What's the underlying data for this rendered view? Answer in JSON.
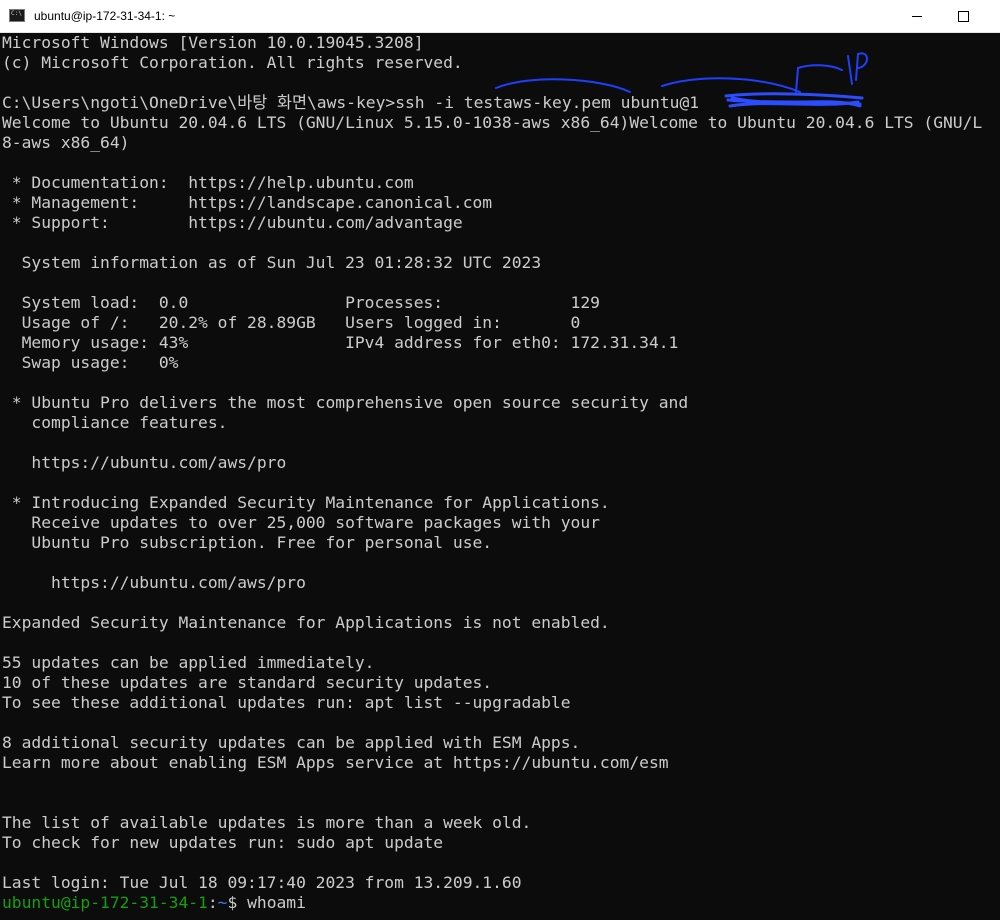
{
  "window": {
    "title": "ubuntu@ip-172-31-34-1: ~",
    "icon": "cmd-console-icon",
    "controls": [
      "minimize",
      "maximize"
    ]
  },
  "terminal": {
    "lines": [
      "Microsoft Windows [Version 10.0.19045.3208]",
      "(c) Microsoft Corporation. All rights reserved.",
      "",
      "C:\\Users\\ngoti\\OneDrive\\바탕 화면\\aws-key>ssh -i testaws-key.pem ubuntu@1",
      "Welcome to Ubuntu 20.04.6 LTS (GNU/Linux 5.15.0-1038-aws x86_64)Welcome to Ubuntu 20.04.6 LTS (GNU/L",
      "8-aws x86_64)",
      "",
      " * Documentation:  https://help.ubuntu.com",
      " * Management:     https://landscape.canonical.com",
      " * Support:        https://ubuntu.com/advantage",
      "",
      "  System information as of Sun Jul 23 01:28:32 UTC 2023",
      "",
      "  System load:  0.0                Processes:             129",
      "  Usage of /:   20.2% of 28.89GB   Users logged in:       0",
      "  Memory usage: 43%                IPv4 address for eth0: 172.31.34.1",
      "  Swap usage:   0%",
      "",
      " * Ubuntu Pro delivers the most comprehensive open source security and",
      "   compliance features.",
      "",
      "   https://ubuntu.com/aws/pro",
      "",
      " * Introducing Expanded Security Maintenance for Applications.",
      "   Receive updates to over 25,000 software packages with your",
      "   Ubuntu Pro subscription. Free for personal use.",
      "",
      "     https://ubuntu.com/aws/pro",
      "",
      "Expanded Security Maintenance for Applications is not enabled.",
      "",
      "55 updates can be applied immediately.",
      "10 of these updates are standard security updates.",
      "To see these additional updates run: apt list --upgradable",
      "",
      "8 additional security updates can be applied with ESM Apps.",
      "Learn more about enabling ESM Apps service at https://ubuntu.com/esm",
      "",
      "",
      "The list of available updates is more than a week old.",
      "To check for new updates run: sudo apt update",
      "",
      "Last login: Tue Jul 18 09:17:40 2023 from 13.209.1.60"
    ],
    "prompt": {
      "user_host": "ubuntu@ip-172-31-34-1",
      "separator": ":",
      "path": "~",
      "symbol": "$ ",
      "command": "whoami"
    },
    "annotation_text": "IP",
    "colors": {
      "background": "#0c0c0c",
      "foreground": "#cccccc",
      "prompt_user": "#13a10e",
      "prompt_path": "#3b78ff",
      "annotation_ink": "#1f3fff"
    }
  }
}
